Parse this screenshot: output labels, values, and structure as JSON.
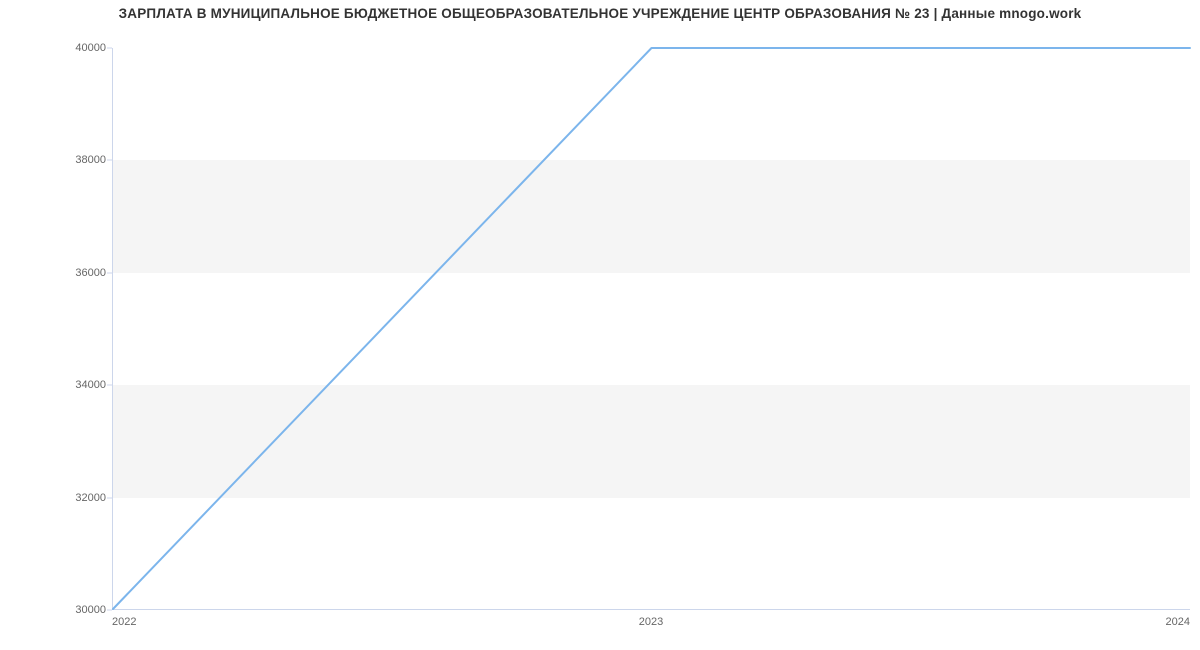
{
  "chart_data": {
    "type": "line",
    "title": "ЗАРПЛАТА В МУНИЦИПАЛЬНОЕ БЮДЖЕТНОЕ ОБЩЕОБРАЗОВАТЕЛЬНОЕ УЧРЕЖДЕНИЕ ЦЕНТР ОБРАЗОВАНИЯ № 23 | Данные mnogo.work",
    "xlabel": "",
    "ylabel": "",
    "x": [
      2022,
      2023,
      2024
    ],
    "values": [
      30000,
      40000,
      40000
    ],
    "x_ticks": [
      "2022",
      "2023",
      "2024"
    ],
    "y_ticks": [
      "30000",
      "32000",
      "34000",
      "36000",
      "38000",
      "40000"
    ],
    "xlim": [
      2022,
      2024
    ],
    "ylim": [
      30000,
      40000
    ],
    "line_color": "#7cb5ec",
    "bands_on": true
  }
}
